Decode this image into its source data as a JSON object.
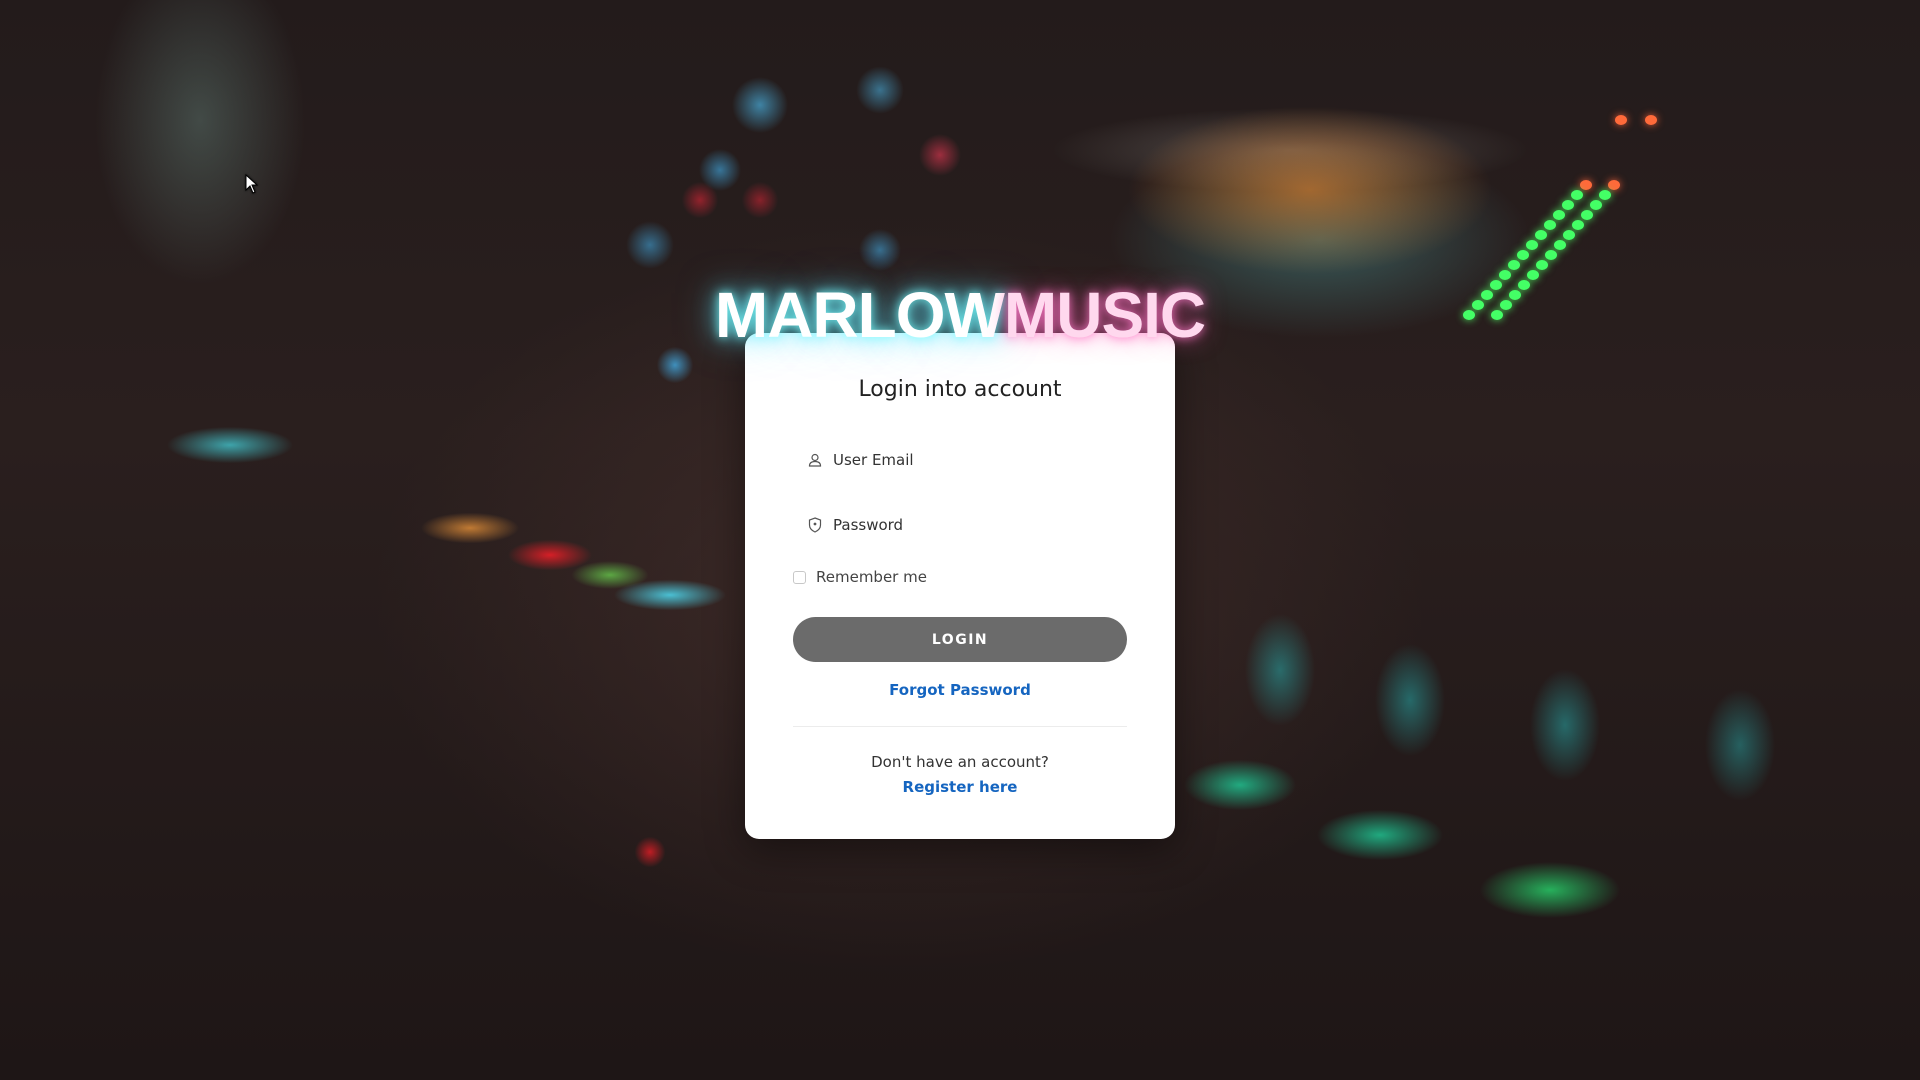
{
  "brand": {
    "part1": "MARLOW",
    "part2": "MUSIC"
  },
  "login_card": {
    "title": "Login into account",
    "email_label": "User Email",
    "email_icon": "user-icon",
    "password_label": "Password",
    "password_icon": "shield-icon",
    "remember_label": "Remember me",
    "remember_checked": false,
    "login_button": "LOGIN",
    "forgot_link": "Forgot Password",
    "no_account_text": "Don't have an account?",
    "register_link": "Register here"
  },
  "colors": {
    "button_bg": "#6b6b6b",
    "link": "#1565c0",
    "card_bg": "#ffffff",
    "brand_glow": "#5ae6ff"
  }
}
